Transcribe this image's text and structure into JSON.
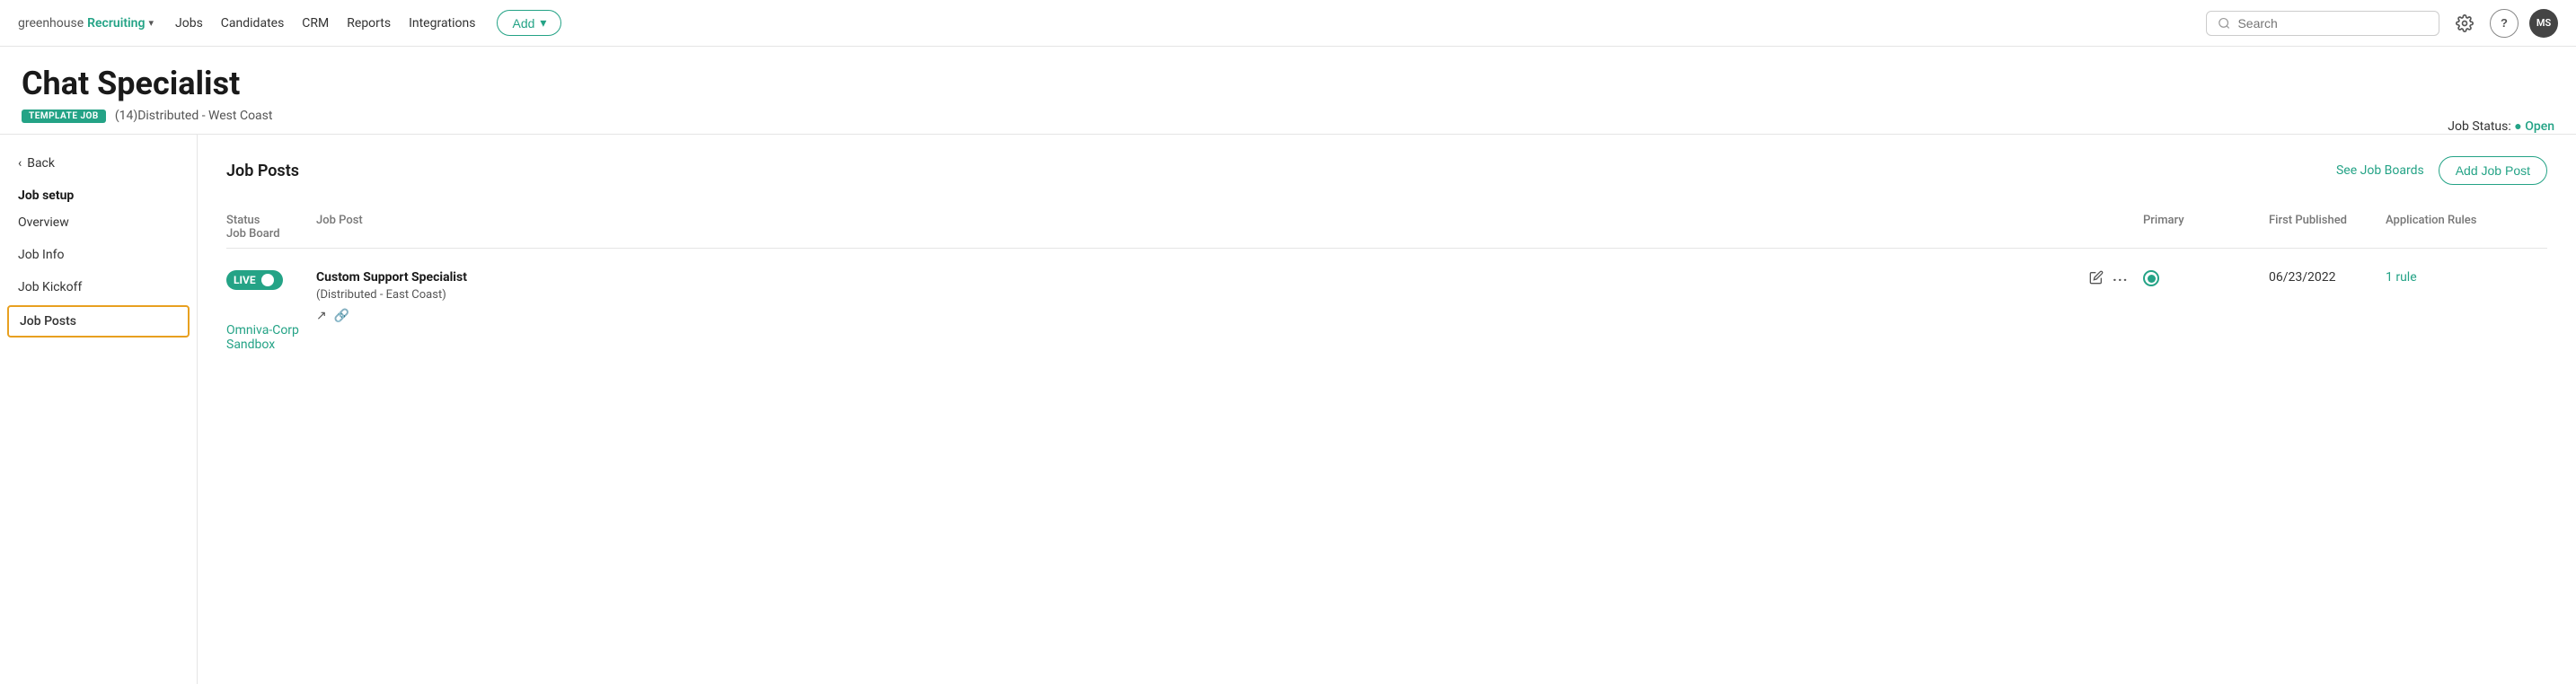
{
  "nav": {
    "logo_greenhouse": "greenhouse",
    "logo_recruiting": "Recruiting",
    "logo_chevron": "▾",
    "links": [
      "Jobs",
      "Candidates",
      "CRM",
      "Reports",
      "Integrations"
    ],
    "add_label": "Add",
    "add_chevron": "▾",
    "search_placeholder": "Search",
    "gear_label": "⚙",
    "help_label": "?",
    "avatar_label": "MS"
  },
  "page": {
    "job_title": "Chat Specialist",
    "template_badge": "TEMPLATE JOB",
    "job_location": "(14)Distributed - West Coast",
    "job_status_label": "Job Status:",
    "job_status_dot": "●",
    "job_status_value": "Open"
  },
  "sidebar": {
    "back_arrow": "‹",
    "back_label": "Back",
    "section_label": "Job setup",
    "items": [
      {
        "id": "overview",
        "label": "Overview"
      },
      {
        "id": "job-info",
        "label": "Job Info"
      },
      {
        "id": "job-kickoff",
        "label": "Job Kickoff"
      },
      {
        "id": "job-posts",
        "label": "Job Posts",
        "active": true
      }
    ]
  },
  "main": {
    "section_title": "Job Posts",
    "see_job_boards_label": "See Job Boards",
    "add_job_post_label": "Add Job Post",
    "table": {
      "columns": [
        "Status",
        "Job Post",
        "",
        "Primary",
        "First Published",
        "Application Rules",
        "Job Board"
      ],
      "rows": [
        {
          "status_label": "LIVE",
          "job_post_name": "Custom Support Specialist",
          "job_post_location": "(Distributed - East Coast)",
          "primary": true,
          "first_published": "06/23/2022",
          "app_rules": "1 rule",
          "job_board": "Omniva-Corp Sandbox"
        }
      ]
    }
  }
}
